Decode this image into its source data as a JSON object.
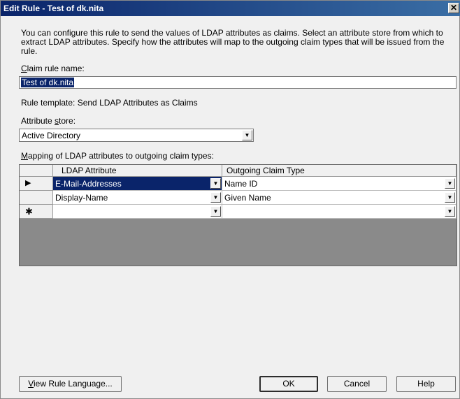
{
  "window": {
    "title": "Edit Rule - Test of dk.nita",
    "close_glyph": "✕"
  },
  "description": "You can configure this rule to send the values of LDAP attributes as claims. Select an attribute store from which to extract LDAP attributes. Specify how the attributes will map to the outgoing claim types that will be issued from the rule.",
  "claim_rule_name": {
    "label_accel": "C",
    "label_rest": "laim rule name:",
    "value": "Test of dk.nita"
  },
  "rule_template": "Rule template: Send LDAP Attributes as Claims",
  "attribute_store": {
    "label_pre": "Attribute ",
    "label_accel": "s",
    "label_post": "tore:",
    "value": "Active Directory"
  },
  "mapping": {
    "label_accel": "M",
    "label_rest": "apping of LDAP attributes to outgoing claim types:",
    "columns": [
      "LDAP Attribute",
      "Outgoing Claim Type"
    ],
    "rows": [
      {
        "marker": "▶",
        "ldap": "E-Mail-Addresses",
        "claim": "Name ID"
      },
      {
        "marker": "",
        "ldap": "Display-Name",
        "claim": "Given Name"
      },
      {
        "marker": "✱",
        "ldap": "",
        "claim": ""
      }
    ]
  },
  "buttons": {
    "view_rule_accel": "V",
    "view_rule_rest": "iew Rule Language...",
    "ok": "OK",
    "cancel": "Cancel",
    "help": "Help"
  },
  "icons": {
    "dropdown_arrow": "▼"
  }
}
